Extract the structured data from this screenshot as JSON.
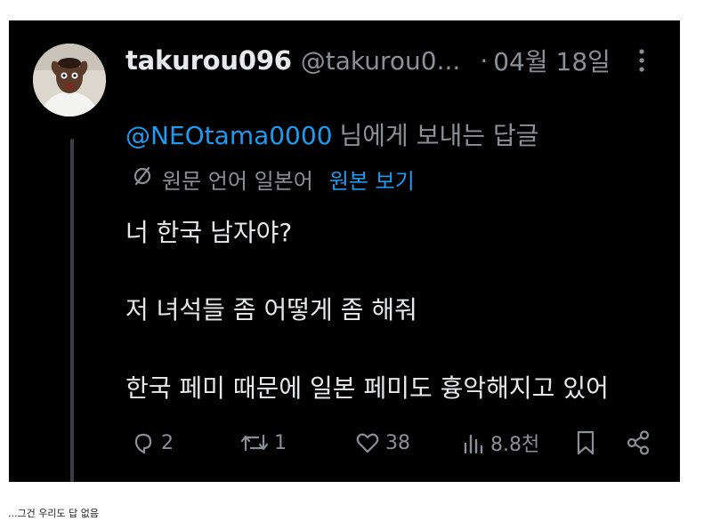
{
  "post": {
    "display_name": "takurou096",
    "handle": "@takurou0...",
    "separator": "·",
    "date": "04월 18일",
    "reply_to_mention": "@NEOtama0000",
    "reply_to_suffix": "님에게 보내는 답글",
    "translation": {
      "language_note": "원문 언어 일본어",
      "show_original": "원본 보기"
    },
    "lines": [
      "너 한국 남자야?",
      "저 녀석들 좀 어떻게 좀 해줘",
      "한국 페미 때문에 일본 페미도 흉악해지고 있어"
    ],
    "actions": {
      "replies": "2",
      "reposts": "1",
      "likes": "38",
      "views": "8.8천"
    }
  },
  "caption": "...그건 우리도 답 없음",
  "colors": {
    "background": "#000000",
    "primary_text": "#e7e9ea",
    "secondary_text": "#8b9096",
    "accent": "#1d9bf0"
  },
  "icons": [
    "avatar",
    "more-icon",
    "translate-icon",
    "reply-icon",
    "repost-icon",
    "like-icon",
    "views-icon",
    "bookmark-icon",
    "share-icon"
  ]
}
